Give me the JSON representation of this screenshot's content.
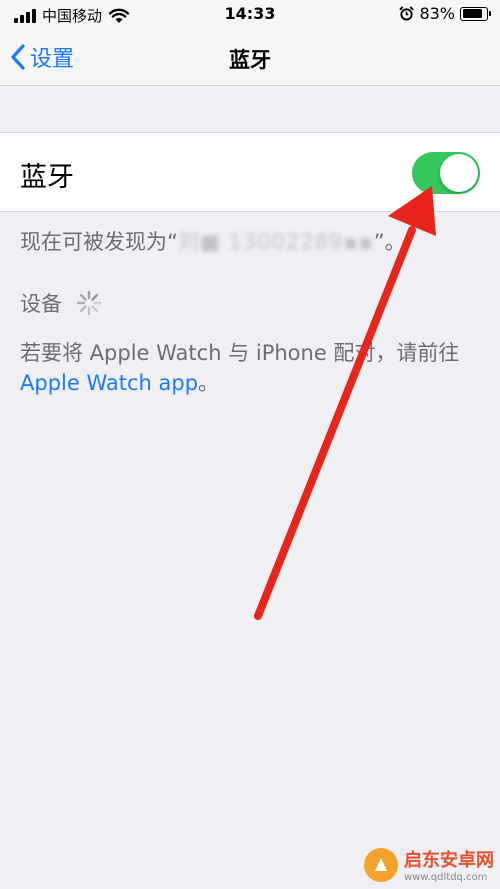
{
  "status_bar": {
    "carrier": "中国移动",
    "time": "14:33",
    "battery_percent": "83%",
    "battery_level": 0.83,
    "icons": [
      "signal-icon",
      "wifi-icon",
      "alarm-icon",
      "battery-icon"
    ]
  },
  "nav": {
    "back_label": "设置",
    "title": "蓝牙"
  },
  "bluetooth": {
    "label": "蓝牙",
    "enabled": true,
    "toggle_color": "#34c759"
  },
  "discoverable": {
    "prefix": "现在可被发现为“",
    "device_name": "刘■ 13002289▪▪",
    "suffix": "”。"
  },
  "devices": {
    "label": "设备"
  },
  "watch_hint": {
    "text": "若要将 Apple Watch 与 iPhone 配对，请前往 ",
    "link": "Apple Watch app",
    "end": "。"
  },
  "watermark": {
    "title": "启东安卓网",
    "url": "www.qdltdq.com"
  },
  "colors": {
    "accent": "#1a7cf5",
    "annotation_arrow": "#e8241c"
  }
}
